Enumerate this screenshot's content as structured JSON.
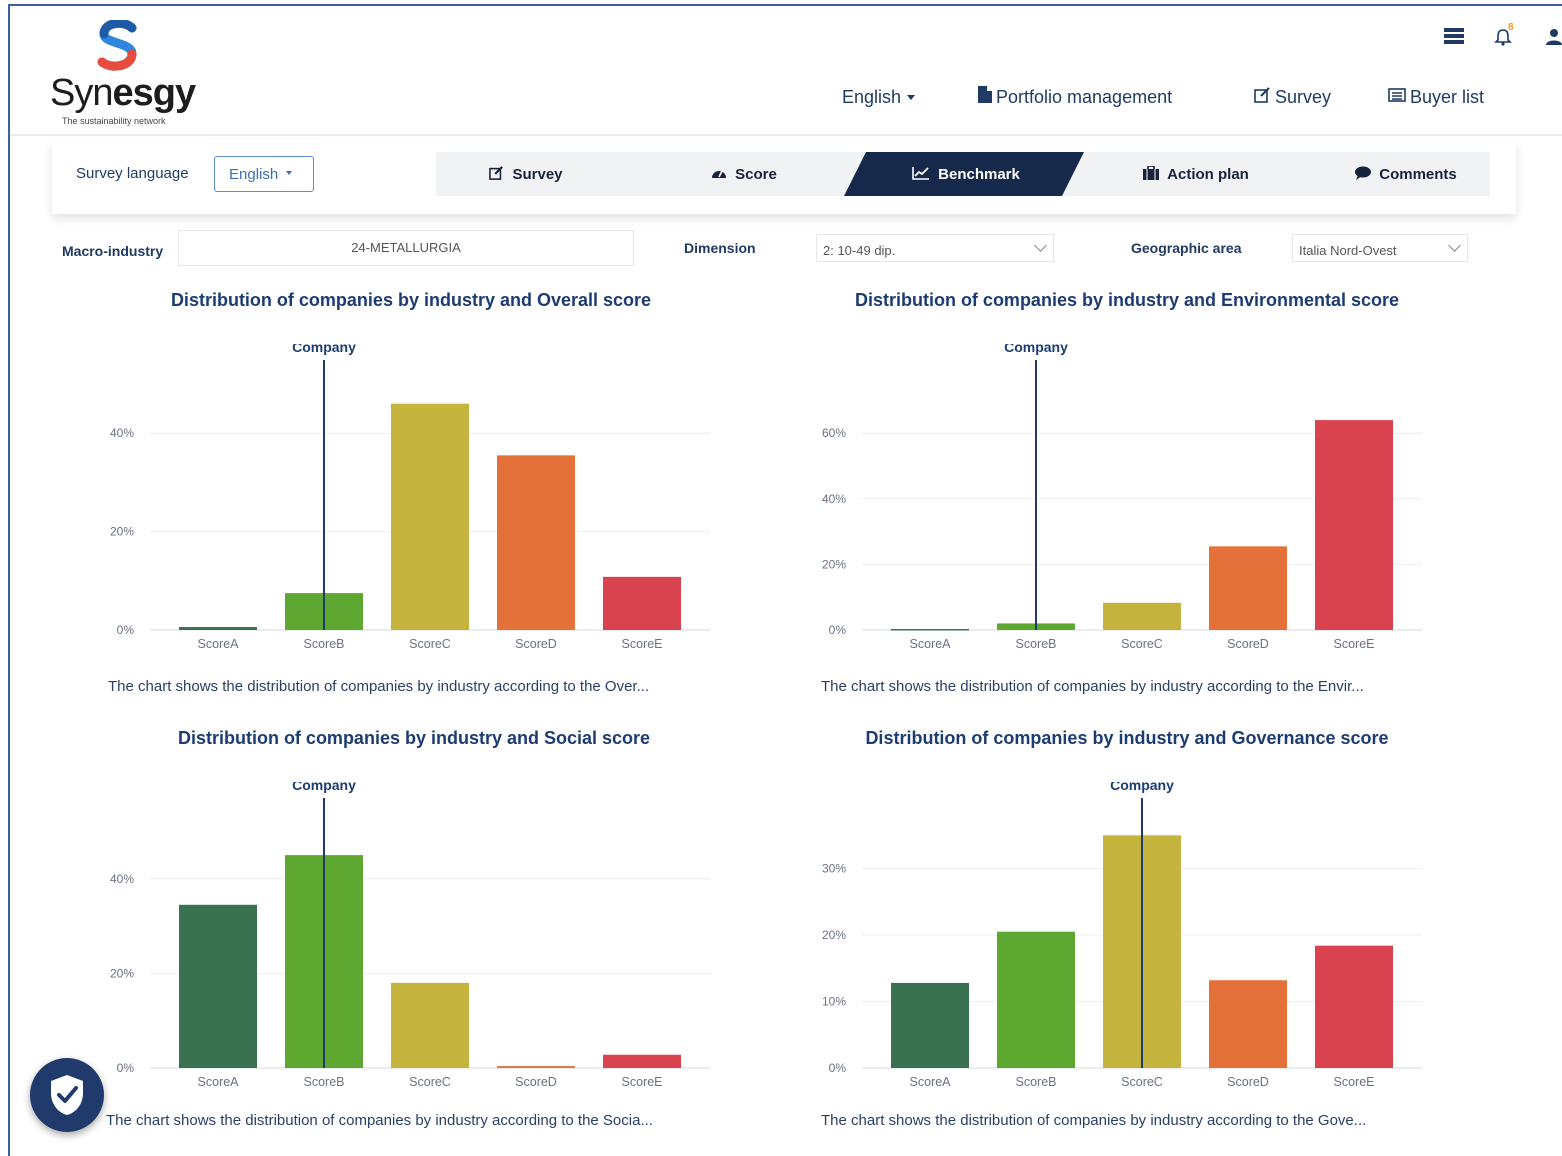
{
  "brand": {
    "name_light": "Syn",
    "name_bold": "esgy",
    "tagline": "The sustainability network"
  },
  "header": {
    "language": "English",
    "nav": [
      {
        "label": "Portfolio management",
        "icon": "file-icon"
      },
      {
        "label": "Survey",
        "icon": "edit-icon"
      },
      {
        "label": "Buyer list",
        "icon": "list-icon"
      }
    ],
    "notifications_count": "8"
  },
  "tabbar": {
    "survey_language_label": "Survey language",
    "survey_language_value": "English",
    "tabs": [
      {
        "label": "Survey",
        "icon": "edit-icon",
        "active": false
      },
      {
        "label": "Score",
        "icon": "dashboard-icon",
        "active": false
      },
      {
        "label": "Benchmark",
        "icon": "line-chart-icon",
        "active": true
      },
      {
        "label": "Action plan",
        "icon": "briefcase-icon",
        "active": false
      },
      {
        "label": "Comments",
        "icon": "comment-icon",
        "active": false
      }
    ]
  },
  "filters": {
    "macro_industry_label": "Macro-industry",
    "macro_industry_value": "24-METALLURGIA",
    "dimension_label": "Dimension",
    "dimension_value": "2: 10-49 dip.",
    "geo_label": "Geographic area",
    "geo_value": "Italia Nord-Ovest"
  },
  "colors": [
    "#3a7150",
    "#5ea832",
    "#c4b33c",
    "#e4703a",
    "#d94350"
  ],
  "chart_data": [
    {
      "type": "bar",
      "title": "Distribution of companies by industry and Overall score",
      "categories": [
        "ScoreA",
        "ScoreB",
        "ScoreC",
        "ScoreD",
        "ScoreE"
      ],
      "values": [
        0.6,
        7.5,
        46,
        35.5,
        10.8
      ],
      "ylim": [
        0,
        50
      ],
      "yticks": [
        0,
        20,
        40
      ],
      "marker": {
        "label": "Company",
        "category": "ScoreB"
      },
      "caption": "The chart shows the distribution of companies by industry according to the Over..."
    },
    {
      "type": "bar",
      "title": "Distribution of companies by industry and Environmental score",
      "categories": [
        "ScoreA",
        "ScoreB",
        "ScoreC",
        "ScoreD",
        "ScoreE"
      ],
      "values": [
        0.3,
        2,
        8.3,
        25.5,
        64
      ],
      "ylim": [
        0,
        75
      ],
      "yticks": [
        0,
        20,
        40,
        60
      ],
      "marker": {
        "label": "Company",
        "category": "ScoreB"
      },
      "caption": "The chart shows the distribution of companies by industry according to the Envir..."
    },
    {
      "type": "bar",
      "title": "Distribution of companies by industry and Social score",
      "categories": [
        "ScoreA",
        "ScoreB",
        "ScoreC",
        "ScoreD",
        "ScoreE"
      ],
      "values": [
        34.5,
        45,
        18,
        0.4,
        2.8
      ],
      "ylim": [
        0,
        52
      ],
      "yticks": [
        0,
        20,
        40
      ],
      "marker": {
        "label": "Company",
        "category": "ScoreB"
      },
      "caption": "The chart shows the distribution of companies by industry according to the Socia..."
    },
    {
      "type": "bar",
      "title": "Distribution of companies by industry and Governance score",
      "categories": [
        "ScoreA",
        "ScoreB",
        "ScoreC",
        "ScoreD",
        "ScoreE"
      ],
      "values": [
        12.8,
        20.5,
        35,
        13.2,
        18.4
      ],
      "ylim": [
        0,
        37
      ],
      "yticks": [
        0,
        10,
        20,
        30
      ],
      "marker": {
        "label": "Company",
        "category": "ScoreC"
      },
      "caption": "The chart shows the distribution of companies by industry according to the Gove..."
    }
  ]
}
